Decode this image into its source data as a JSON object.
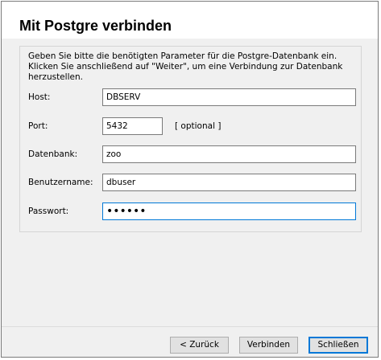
{
  "dialog": {
    "title": "Mit Postgre verbinden",
    "description": "Geben Sie bitte die benötigten Parameter für die Postgre-Datenbank ein. Klicken Sie anschließend auf \"Weiter\", um eine Verbindung zur Datenbank herzustellen."
  },
  "form": {
    "host_label": "Host:",
    "host_value": "DBSERV",
    "port_label": "Port:",
    "port_value": "5432",
    "port_hint": "[ optional ]",
    "database_label": "Datenbank:",
    "database_value": "zoo",
    "user_label": "Benutzername:",
    "user_value": "dbuser",
    "password_label": "Passwort:",
    "password_value": "••••••"
  },
  "buttons": {
    "back": "< Zurück",
    "connect": "Verbinden",
    "close": "Schließen"
  }
}
